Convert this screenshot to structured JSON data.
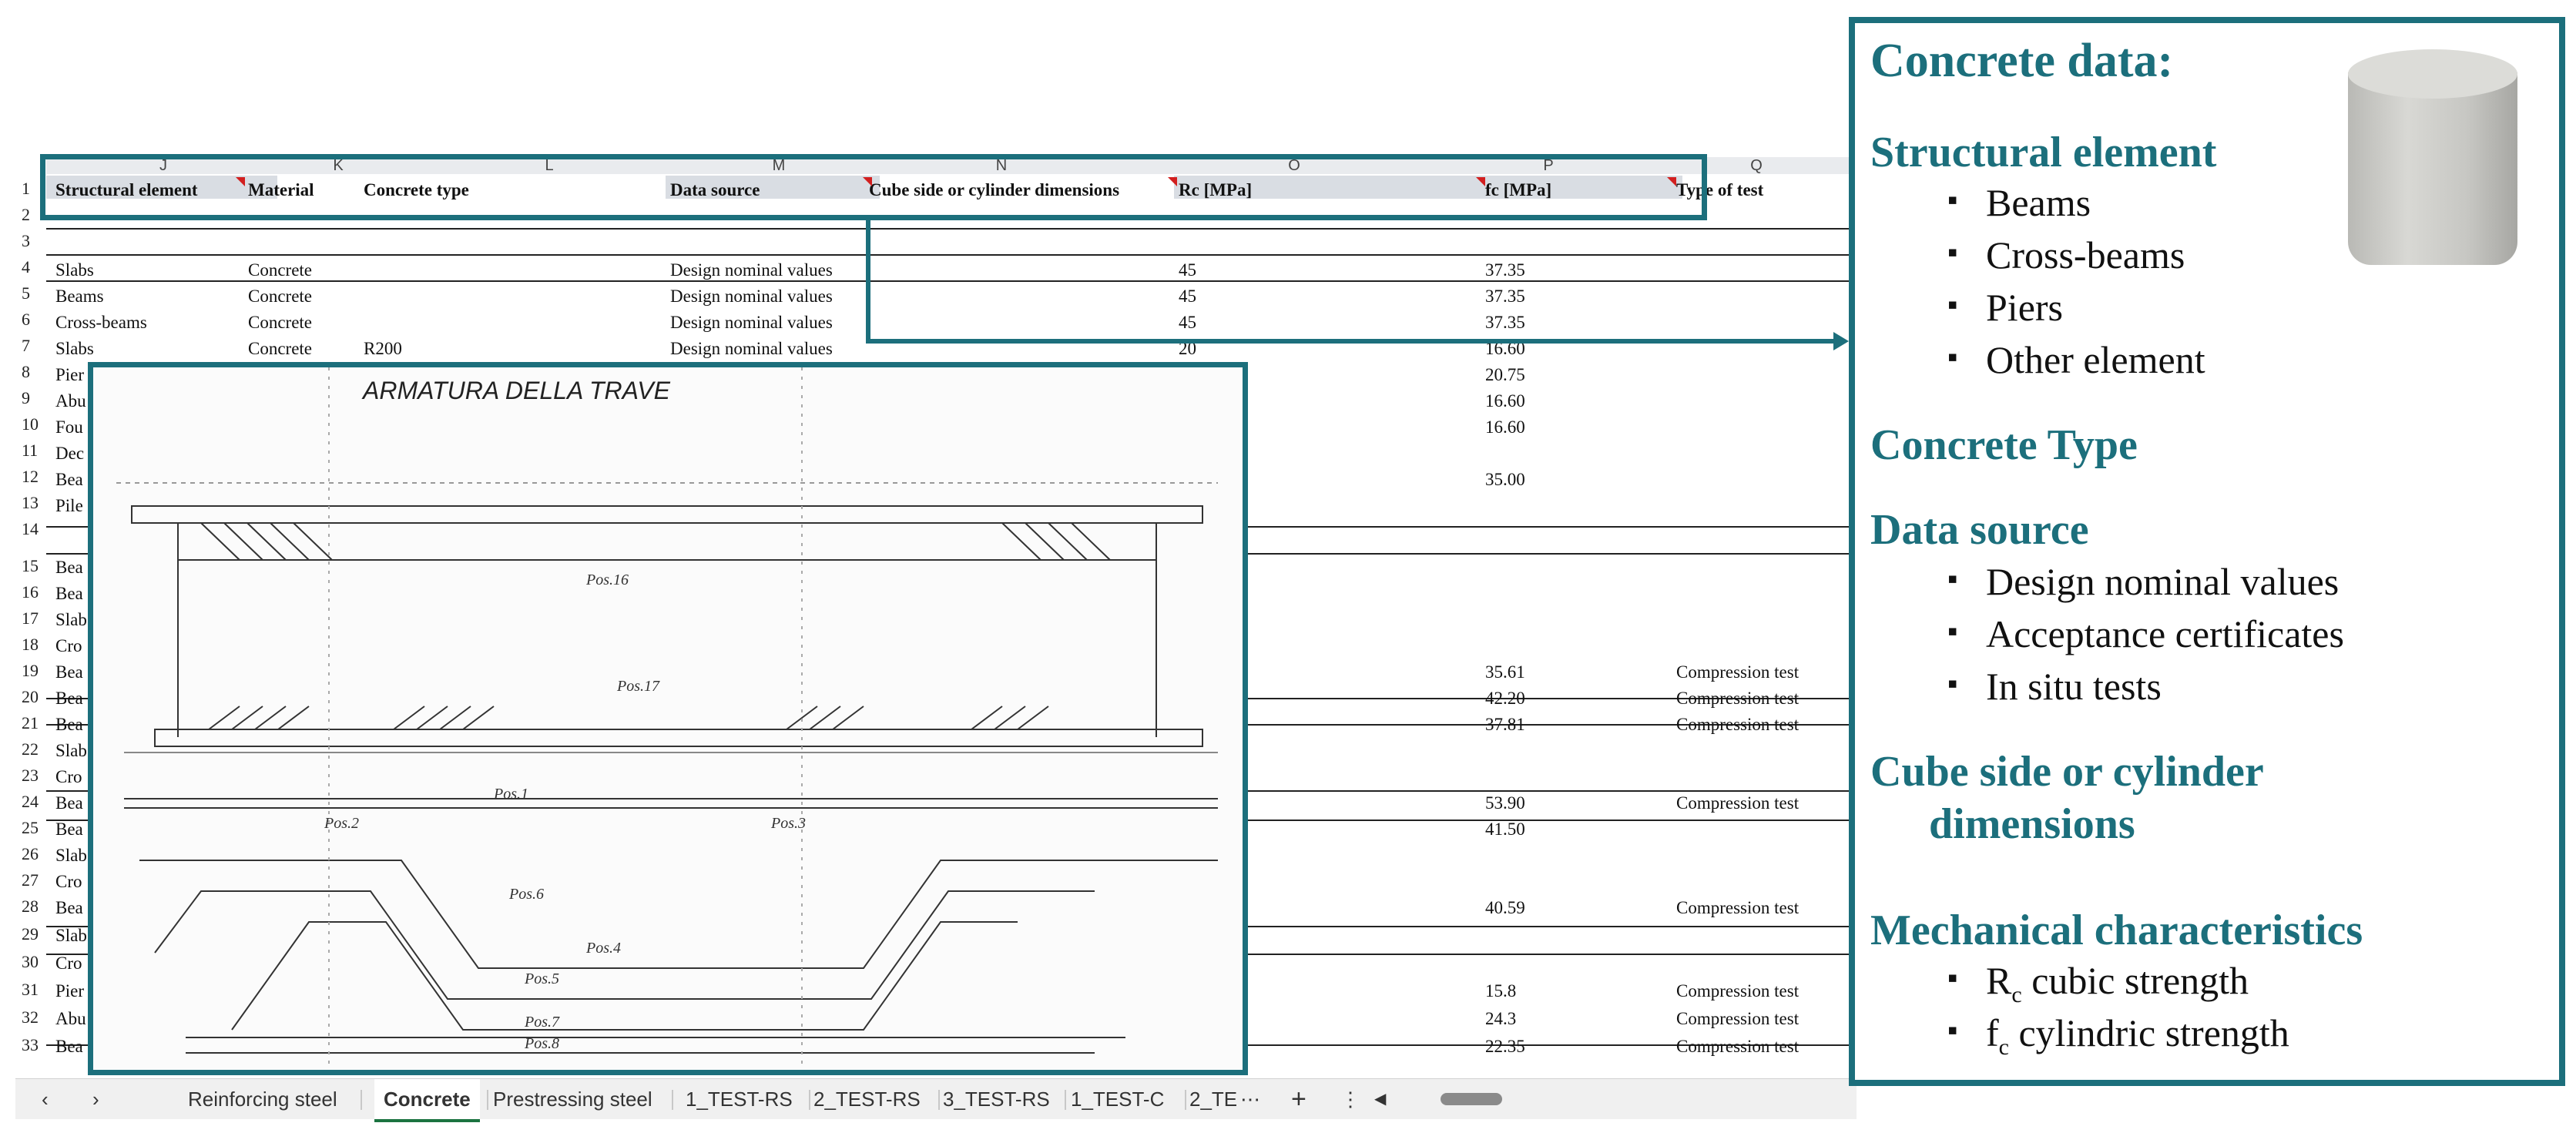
{
  "columns": [
    "J",
    "K",
    "L",
    "M",
    "N",
    "O",
    "P",
    "Q"
  ],
  "headers": {
    "structural_element": "Structural element",
    "material": "Material",
    "concrete_type": "Concrete type",
    "data_source": "Data source",
    "cube_side": "Cube side or cylinder dimensions",
    "rc": "Rc [MPa]",
    "fc": "fc [MPa]",
    "type_of_test": "Type of test"
  },
  "row_numbers": [
    "1",
    "2",
    "3",
    "4",
    "5",
    "6",
    "7",
    "8",
    "9",
    "10",
    "11",
    "12",
    "13",
    "14",
    "15",
    "16",
    "17",
    "18",
    "19",
    "20",
    "21",
    "22",
    "23",
    "24",
    "25",
    "26",
    "27",
    "28",
    "29",
    "30",
    "31",
    "32",
    "33"
  ],
  "rows": [
    {
      "el": "Slabs",
      "mat": "Concrete",
      "type": "",
      "src": "Design nominal values",
      "rc": "45",
      "fc": "37.35",
      "test": ""
    },
    {
      "el": "Beams",
      "mat": "Concrete",
      "type": "",
      "src": "Design nominal values",
      "rc": "45",
      "fc": "37.35",
      "test": ""
    },
    {
      "el": "Cross-beams",
      "mat": "Concrete",
      "type": "",
      "src": "Design nominal values",
      "rc": "45",
      "fc": "37.35",
      "test": ""
    },
    {
      "el": "Slabs",
      "mat": "Concrete",
      "type": "R200",
      "src": "Design nominal values",
      "rc": "20",
      "fc": "16.60",
      "test": ""
    },
    {
      "el": "Pier",
      "rc": "",
      "fc": "20.75",
      "test": ""
    },
    {
      "el": "Abu",
      "fc": "16.60",
      "test": ""
    },
    {
      "el": "Fou",
      "fc": "16.60",
      "test": ""
    },
    {
      "el": "Dec",
      "fc": "",
      "test": ""
    },
    {
      "el": "Bea",
      "fc": "35.00",
      "test": ""
    },
    {
      "el": "Pile",
      "fc": "",
      "test": ""
    }
  ],
  "lower_rows": [
    {
      "num": "15",
      "el": "Bea",
      "fc": "",
      "test": ""
    },
    {
      "num": "16",
      "el": "Bea",
      "fc": "",
      "test": ""
    },
    {
      "num": "17",
      "el": "Slab",
      "fc": "",
      "test": ""
    },
    {
      "num": "18",
      "el": "Cro",
      "fc": "",
      "test": ""
    },
    {
      "num": "19",
      "el": "Bea",
      "fc": "35.61",
      "test": "Compression test"
    },
    {
      "num": "20",
      "el": "Bea",
      "fc": "42.20",
      "test": "Compression test"
    },
    {
      "num": "21",
      "el": "Bea",
      "fc": "37.81",
      "test": "Compression test"
    },
    {
      "num": "22",
      "el": "Slab",
      "fc": "",
      "test": ""
    },
    {
      "num": "23",
      "el": "Cro",
      "fc": "",
      "test": ""
    },
    {
      "num": "24",
      "el": "Bea",
      "fc": "53.90",
      "test": "Compression test"
    },
    {
      "num": "25",
      "el": "Bea",
      "fc": "41.50",
      "test": ""
    },
    {
      "num": "26",
      "el": "Slab",
      "fc": "",
      "test": ""
    },
    {
      "num": "27",
      "el": "Cro",
      "fc": "",
      "test": ""
    },
    {
      "num": "28",
      "el": "Bea",
      "fc": "40.59",
      "test": "Compression test"
    },
    {
      "num": "29",
      "el": "Slab",
      "fc": "",
      "test": ""
    },
    {
      "num": "30",
      "el": "Cro",
      "fc": "",
      "test": ""
    },
    {
      "num": "31",
      "el": "Pier",
      "fc": "15.8",
      "test": "Compression test"
    },
    {
      "num": "32",
      "el": "Abu",
      "fc": "24.3",
      "test": "Compression test"
    },
    {
      "num": "33",
      "el": "Bea",
      "fc": "22.35",
      "test": "Compression test"
    }
  ],
  "drawing": {
    "title": "ARMATURA DELLA TRAVE",
    "labels": [
      "Pos.16",
      "Pos.17",
      "Pos.1",
      "Pos.2",
      "Pos.3",
      "Pos.4",
      "Pos.5",
      "Pos.6",
      "Pos.7",
      "Pos.8"
    ]
  },
  "tabs": [
    "Reinforcing steel",
    "Concrete",
    "Prestressing steel",
    "1_TEST-RS",
    "2_TEST-RS",
    "3_TEST-RS",
    "1_TEST-C",
    "2_TE"
  ],
  "active_tab": "Concrete",
  "info_panel": {
    "title": "Concrete data:",
    "sections": [
      {
        "heading": "Structural element",
        "items": [
          "Beams",
          "Cross-beams",
          "Piers",
          "Other element"
        ]
      },
      {
        "heading": "Concrete Type",
        "items": []
      },
      {
        "heading": "Data source",
        "items": [
          "Design nominal values",
          "Acceptance certificates",
          "In situ tests"
        ]
      },
      {
        "heading": "Cube side or cylinder",
        "heading2": "dimensions",
        "items": []
      },
      {
        "heading": "Mechanical characteristics",
        "items": []
      }
    ],
    "mech_items": [
      {
        "sym": "R",
        "sub": "c",
        "text": " cubic strength"
      },
      {
        "sym": "f",
        "sub": "c",
        "text": " cylindric strength"
      }
    ]
  },
  "colors": {
    "accent": "#1c6f7c",
    "tab_active": "#1b7340"
  }
}
